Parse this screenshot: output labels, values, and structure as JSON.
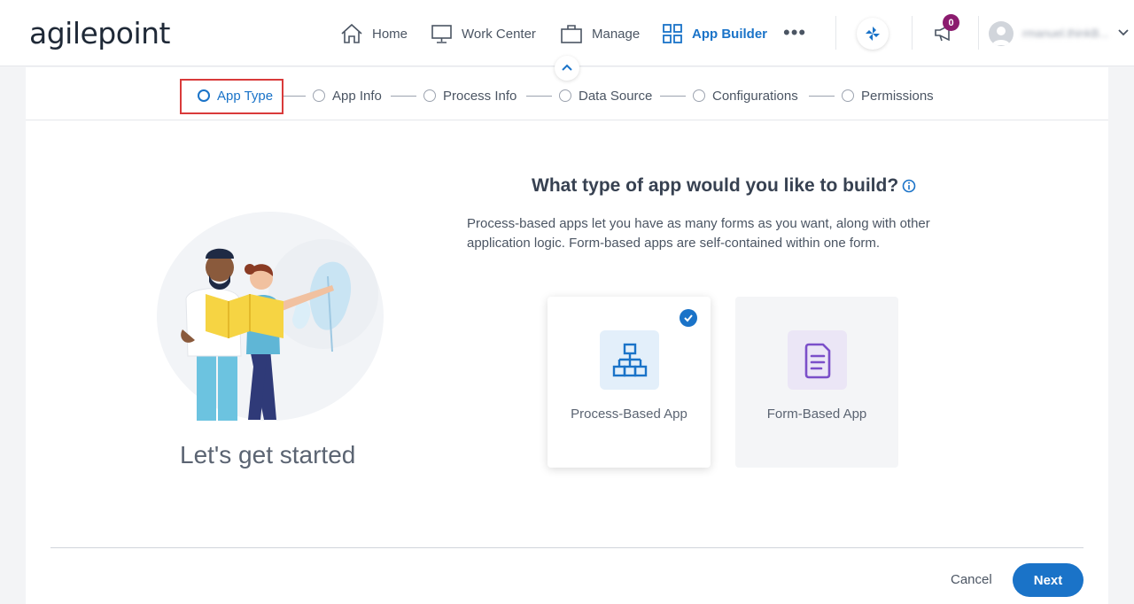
{
  "brand": {
    "logo_text": "agilepoint"
  },
  "nav": {
    "items": [
      {
        "label": "Home",
        "icon": "home-icon"
      },
      {
        "label": "Work Center",
        "icon": "monitor-icon"
      },
      {
        "label": "Manage",
        "icon": "briefcase-icon"
      },
      {
        "label": "App Builder",
        "icon": "grid-icon",
        "active": true
      }
    ],
    "more_label": "•••",
    "notifications_count": "0",
    "user_name": "rmanuel.thinkB..."
  },
  "stepper": {
    "steps": [
      {
        "label": "App Type",
        "active": true
      },
      {
        "label": "App Info"
      },
      {
        "label": "Process Info"
      },
      {
        "label": "Data Source"
      },
      {
        "label": "Configurations"
      },
      {
        "label": "Permissions"
      }
    ]
  },
  "hero": {
    "caption": "Let's get started"
  },
  "main": {
    "question": "What type of app would you like to build?",
    "description": "Process-based apps let you have as many forms as you want, along with other application logic. Form-based apps are self-contained within one form.",
    "options": [
      {
        "label": "Process-Based App",
        "icon": "process-diagram-icon",
        "selected": true
      },
      {
        "label": "Form-Based App",
        "icon": "form-document-icon",
        "selected": false
      }
    ]
  },
  "footer": {
    "cancel_label": "Cancel",
    "next_label": "Next"
  },
  "colors": {
    "accent": "#1a73c8",
    "highlight": "#d93a3a",
    "badge": "#8b1b6e",
    "form_accent": "#7b4fc9"
  }
}
